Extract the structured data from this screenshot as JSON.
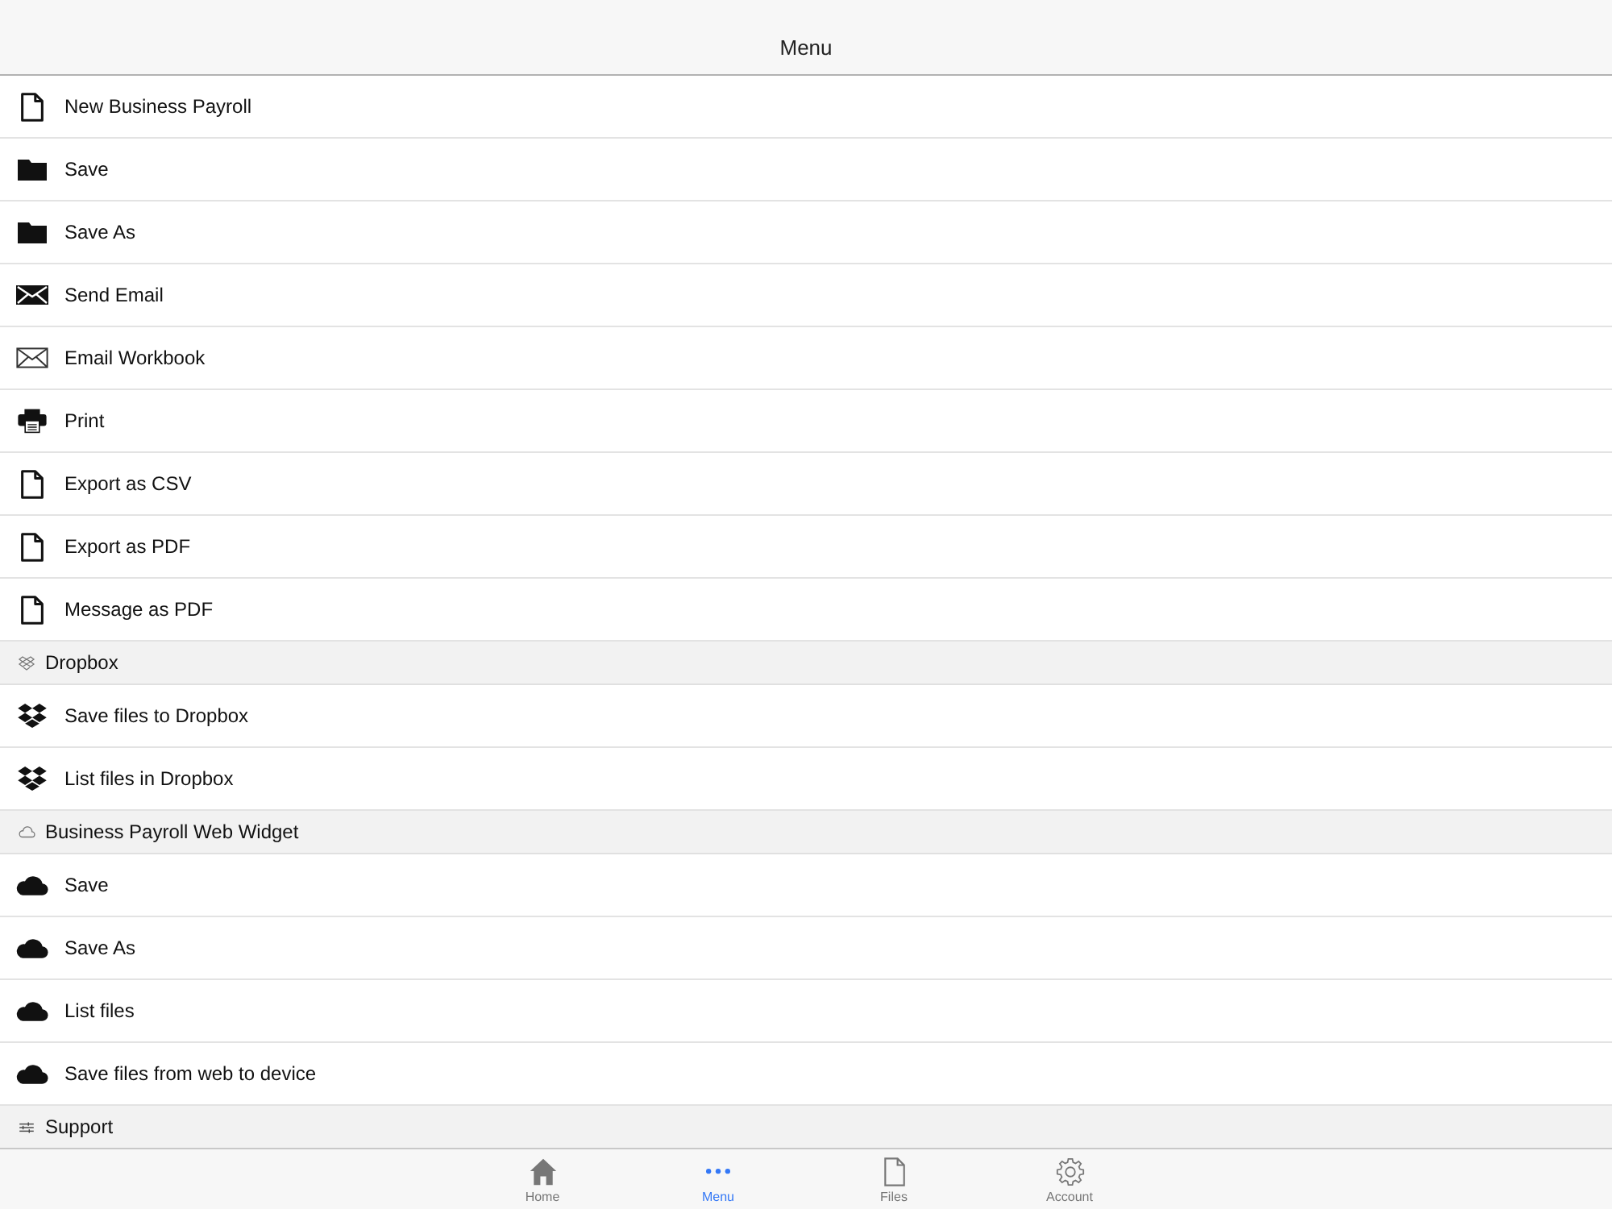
{
  "header": {
    "title": "Menu"
  },
  "sections": [
    {
      "items": [
        {
          "label": "New Business Payroll",
          "kind": "document"
        },
        {
          "label": "Save",
          "kind": "folder"
        },
        {
          "label": "Save As",
          "kind": "folder"
        },
        {
          "label": "Send Email",
          "kind": "envelope-filled"
        },
        {
          "label": "Email Workbook",
          "kind": "envelope-outline"
        },
        {
          "label": "Print",
          "kind": "printer"
        },
        {
          "label": "Export as CSV",
          "kind": "document"
        },
        {
          "label": "Export as PDF",
          "kind": "document"
        },
        {
          "label": "Message as PDF",
          "kind": "document"
        }
      ]
    },
    {
      "title": "Dropbox",
      "kind": "dropbox",
      "items": [
        {
          "label": "Save files to Dropbox",
          "kind": "dropbox"
        },
        {
          "label": "List files in Dropbox",
          "kind": "dropbox"
        }
      ]
    },
    {
      "title": "Business Payroll Web Widget",
      "kind": "cloud",
      "items": [
        {
          "label": "Save",
          "kind": "cloud"
        },
        {
          "label": "Save As",
          "kind": "cloud"
        },
        {
          "label": "List files",
          "kind": "cloud"
        },
        {
          "label": "Save files from web to device",
          "kind": "cloud"
        }
      ]
    },
    {
      "title": "Support",
      "kind": "sliders"
    }
  ],
  "tabs": [
    {
      "label": "Home",
      "kind": "home",
      "selected": false
    },
    {
      "label": "Menu",
      "kind": "dots",
      "selected": true
    },
    {
      "label": "Files",
      "kind": "document",
      "selected": false
    },
    {
      "label": "Account",
      "kind": "gear",
      "selected": false
    }
  ]
}
